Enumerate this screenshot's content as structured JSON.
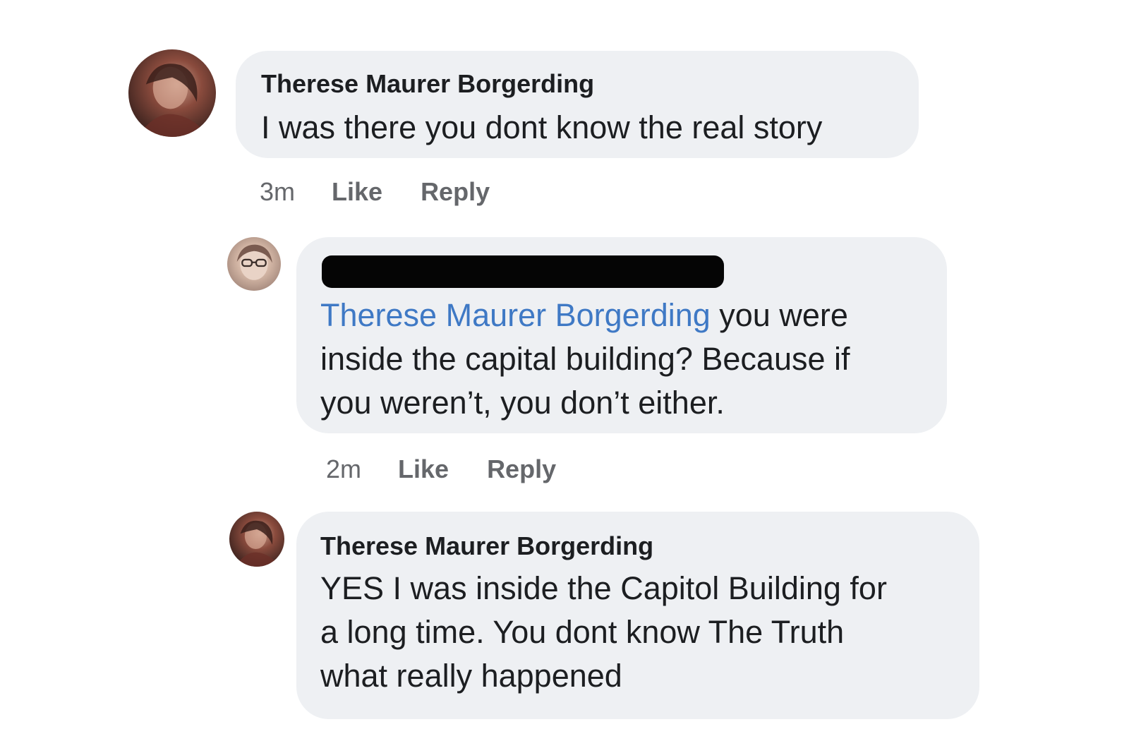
{
  "comments": [
    {
      "author": "Therese Maurer Borgerding",
      "text": "I was there you dont know the real story",
      "time": "3m",
      "like_label": "Like",
      "reply_label": "Reply"
    },
    {
      "author_redacted": true,
      "mention": "Therese Maurer Borgerding",
      "text_lines": [
        " you were",
        "inside the capital building? Because if",
        "you weren’t, you don’t either."
      ],
      "time": "2m",
      "like_label": "Like",
      "reply_label": "Reply"
    },
    {
      "author": "Therese Maurer Borgerding",
      "text_lines": [
        "YES I was inside the Capitol Building for",
        "a long time. You dont know The Truth",
        "what really happened"
      ]
    }
  ],
  "colors": {
    "bubble_bg": "#eef0f3",
    "mention": "#3f79c5",
    "meta_text": "#65676b",
    "primary_text": "#1c1e21"
  },
  "icons": [
    "profile-photo-avatar"
  ]
}
